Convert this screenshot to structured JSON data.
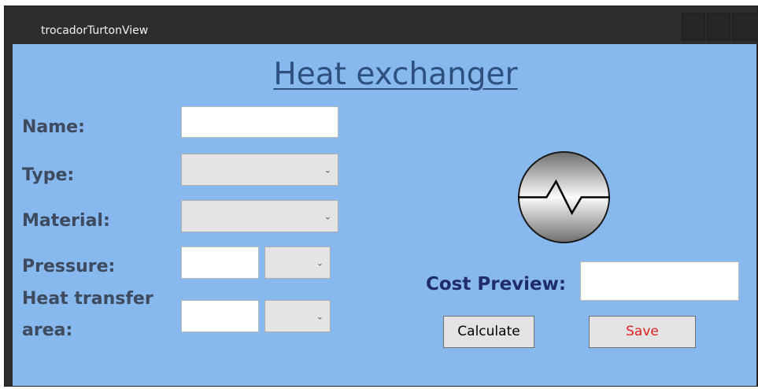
{
  "window": {
    "title": "trocadorTurtonView"
  },
  "form": {
    "heading": "Heat exchanger",
    "name_label": "Name:",
    "name_value": "",
    "type_label": "Type:",
    "type_selected": "",
    "material_label": "Material:",
    "material_selected": "",
    "pressure_label": "Pressure:",
    "pressure_value": "",
    "pressure_unit": "",
    "area_label_line1": "Heat transfer",
    "area_label_line2": "area:",
    "area_value": "",
    "area_unit": "",
    "cost_label": "Cost Preview:",
    "cost_value": "",
    "calculate_label": "Calculate",
    "save_label": "Save"
  },
  "icons": {
    "dropdown_arrow": "chevron-down-icon",
    "heat_exchanger": "heat-exchanger-icon"
  },
  "colors": {
    "background": "#87b8ee",
    "heading": "#2f4f7f",
    "labels": "#3e4a5d",
    "cost_label": "#1f2d6b",
    "save_text": "#e02020",
    "titlebar": "#2d2d30"
  }
}
